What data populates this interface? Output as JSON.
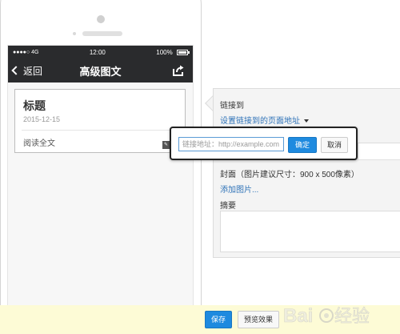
{
  "statusbar": {
    "carrier": "●●●●○ 4G",
    "time": "12:00",
    "battery": "100%",
    "battery_level": 1.0
  },
  "navbar": {
    "back_label": "返回",
    "title": "高级图文",
    "share_icon": "share-icon"
  },
  "article": {
    "title": "标题",
    "date": "2015-12-15",
    "read_more": "阅读全文"
  },
  "editor": {
    "link_to_label": "链接到",
    "set_link_label": "设置链接到的页面地址",
    "cover_label": "封面（图片建议尺寸：900 x 500像素）",
    "add_image_label": "添加图片...",
    "summary_label": "摘要",
    "summary_value": ""
  },
  "link_popup": {
    "placeholder": "链接地址：http://example.com",
    "value": "",
    "confirm_label": "确定",
    "cancel_label": "取消"
  },
  "bottom": {
    "save_label": "保存",
    "preview_label": "预览效果"
  },
  "watermark": {
    "text": "Baidu 经验"
  },
  "colors": {
    "primary": "#1e8adf",
    "link": "#2f73b8",
    "dark_bar": "#2a2b2d",
    "bottom_bar": "#fdfbd6"
  }
}
